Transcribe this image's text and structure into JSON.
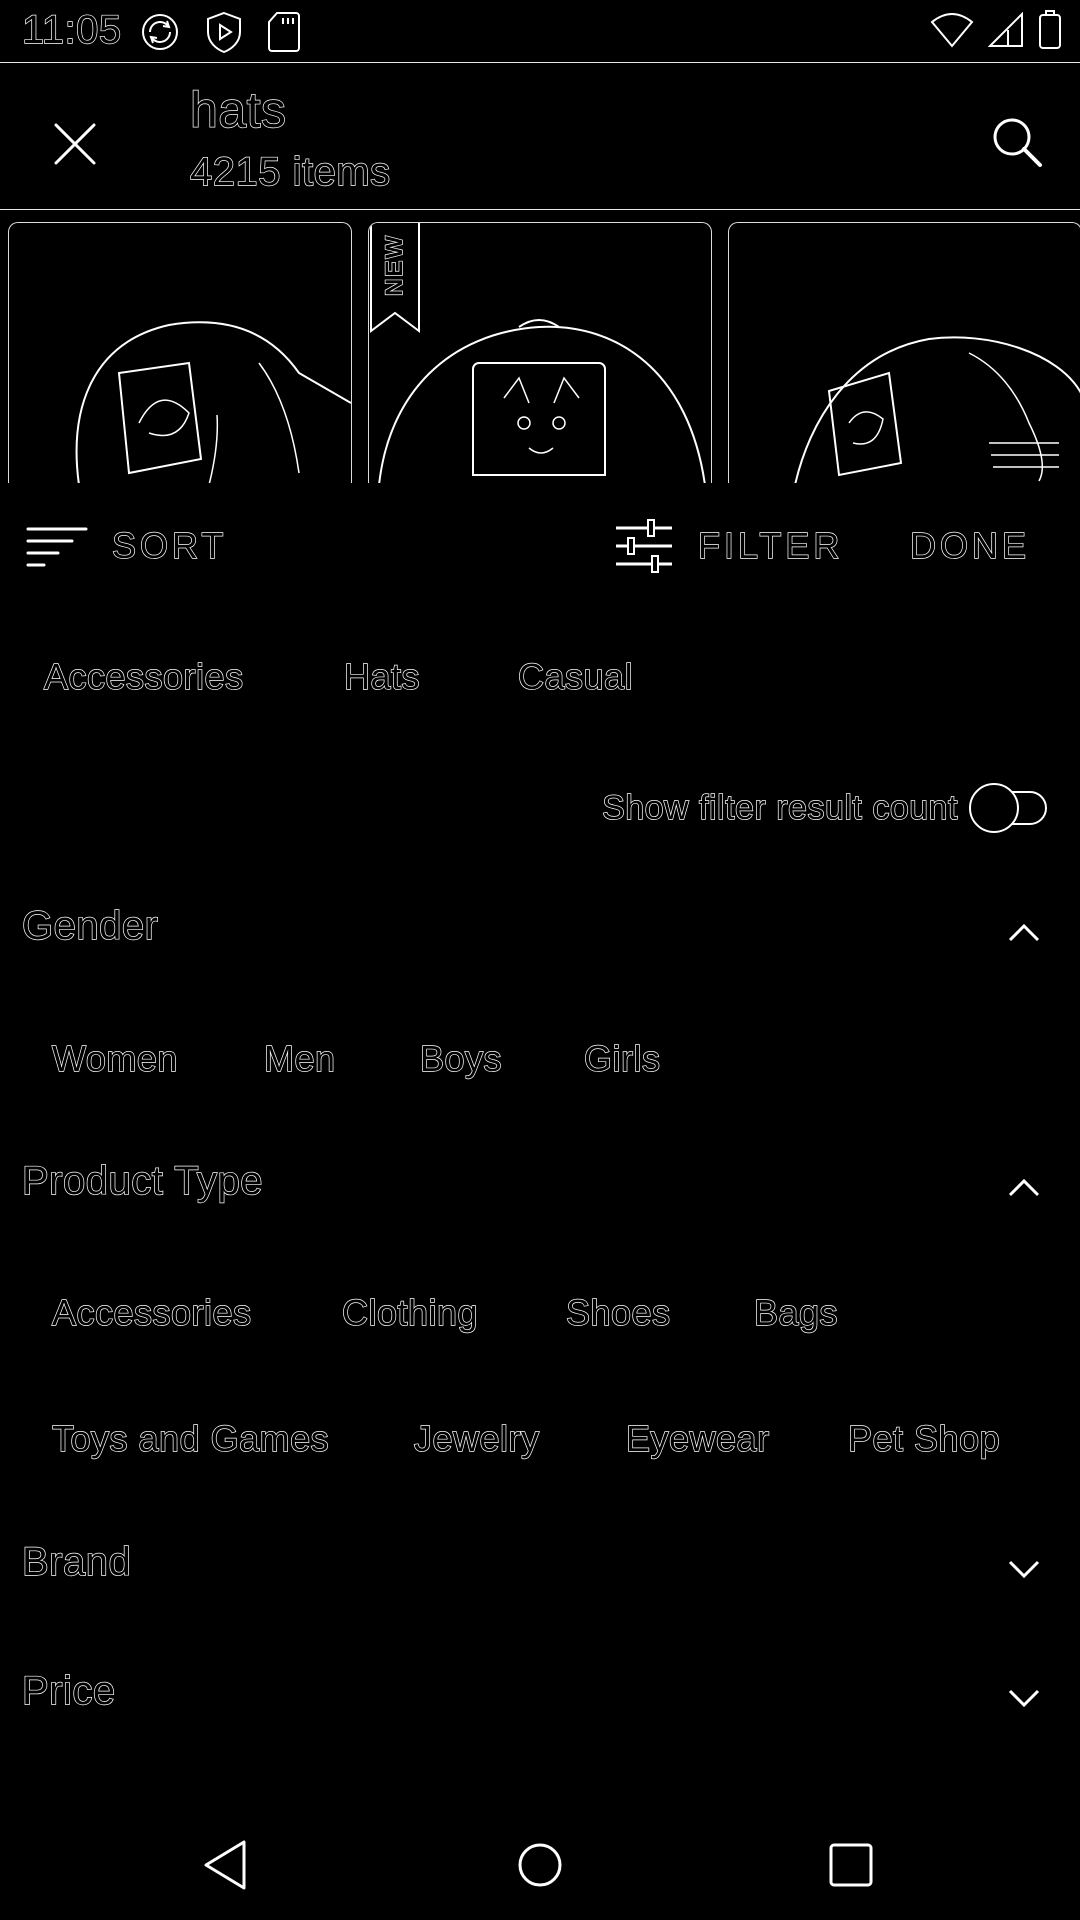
{
  "status": {
    "time": "11:05",
    "left_icons": [
      "sync-icon",
      "play-shield-icon",
      "sd-card-icon"
    ],
    "right_icons": [
      "wifi-icon",
      "signal-icon",
      "battery-icon"
    ]
  },
  "app_bar": {
    "query": "hats",
    "count": "4215 items"
  },
  "products": {
    "cards": [
      {
        "badge": ""
      },
      {
        "badge": "NEW"
      },
      {
        "badge": ""
      }
    ]
  },
  "sortbar": {
    "sort_label": "SORT",
    "filter_label": "FILTER",
    "done_label": "DONE"
  },
  "breadcrumbs": [
    "Accessories",
    "Hats",
    "Casual"
  ],
  "toggle": {
    "label": "Show filter result count",
    "on": false
  },
  "sections": {
    "gender": {
      "title": "Gender",
      "expanded": true,
      "options": [
        "Women",
        "Men",
        "Boys",
        "Girls"
      ]
    },
    "product_type": {
      "title": "Product Type",
      "expanded": true,
      "options_row1": [
        "Accessories",
        "Clothing",
        "Shoes",
        "Bags"
      ],
      "options_row2": [
        "Toys and Games",
        "Jewelry",
        "Eyewear",
        "Pet Shop"
      ]
    },
    "brand": {
      "title": "Brand",
      "expanded": false
    },
    "price": {
      "title": "Price",
      "expanded": false
    }
  },
  "colors": {
    "background": "#000000",
    "outline": "#ffffff"
  }
}
